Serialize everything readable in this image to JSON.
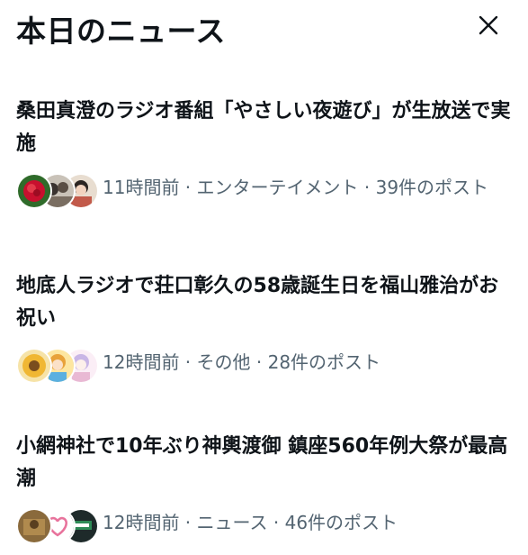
{
  "header": {
    "title": "本日のニュース",
    "close_icon": "close-icon"
  },
  "news": [
    {
      "headline": "桑田真澄のラジオ番組「やさしい夜遊び」が生放送で実施",
      "meta": "11時間前 · エンターテイメント · 39件のポスト",
      "avatars": [
        "red-flower-avatar",
        "group-photo-avatar",
        "girl-avatar"
      ]
    },
    {
      "headline": "地底人ラジオで荘口彰久の58歳誕生日を福山雅治がお祝い",
      "meta": "12時間前 · その他 · 28件のポスト",
      "avatars": [
        "sunflower-avatar",
        "anime-character-avatar",
        "anime-girl-avatar"
      ]
    },
    {
      "headline": "小網神社で10年ぶり神輿渡御 鎮座560年例大祭が最高潮",
      "meta": "12時間前 · ニュース · 46件のポスト",
      "avatars": [
        "shrine-photo-avatar",
        "heart-avatar",
        "station-sign-avatar"
      ]
    }
  ],
  "colors": {
    "text_primary": "#0f1419",
    "text_secondary": "#536471",
    "background": "#ffffff"
  }
}
